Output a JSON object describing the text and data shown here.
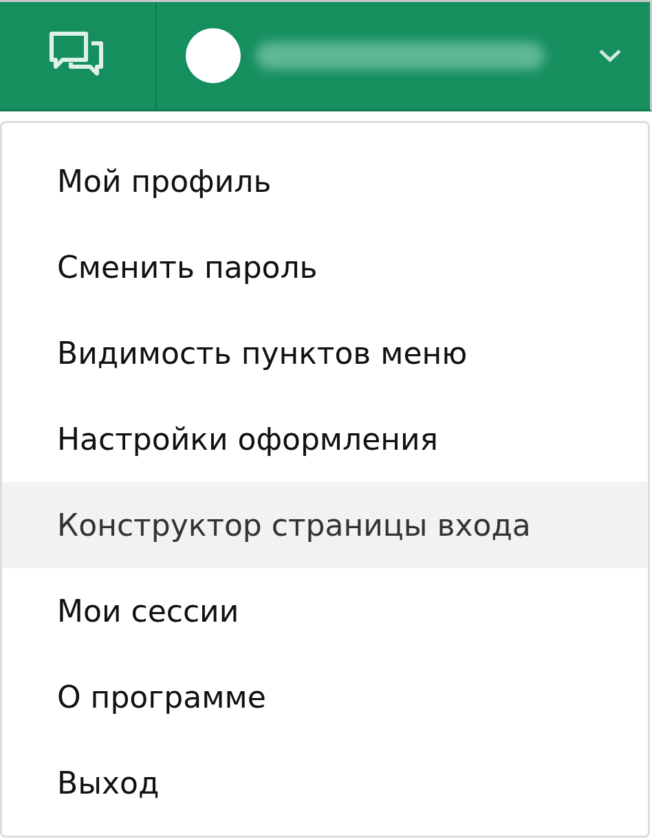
{
  "header": {
    "user_name_redacted": true
  },
  "menu": {
    "items": [
      {
        "label": "Мой профиль",
        "selected": false
      },
      {
        "label": "Сменить пароль",
        "selected": false
      },
      {
        "label": "Видимость пунктов меню",
        "selected": false
      },
      {
        "label": "Настройки оформления",
        "selected": false
      },
      {
        "label": "Конструктор страницы входа",
        "selected": true
      },
      {
        "label": "Мои сессии",
        "selected": false
      },
      {
        "label": "О программе",
        "selected": false
      },
      {
        "label": "Выход",
        "selected": false
      }
    ]
  }
}
